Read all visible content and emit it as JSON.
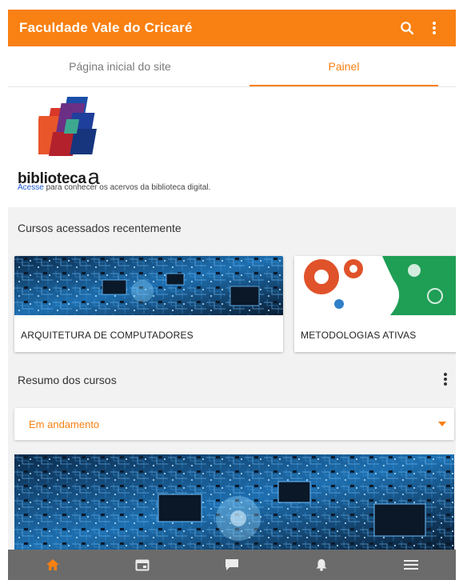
{
  "app": {
    "title": "Faculdade Vale do Cricaré",
    "accent_color": "#f98012",
    "actions": [
      {
        "icon": "search-icon"
      },
      {
        "icon": "kebab-menu-icon"
      }
    ]
  },
  "tabs": [
    {
      "label": "Página inicial do site",
      "active": false
    },
    {
      "label": "Painel",
      "active": true
    }
  ],
  "biblioteca": {
    "wordmark": "biblioteca",
    "wordmark_glyph": "a",
    "link_text": "Acesse",
    "caption_rest": " para conhecer os acervos da biblioteca digital."
  },
  "recent": {
    "header": "Cursos acessados recentemente",
    "courses": [
      {
        "title": "ARQUITETURA DE COMPUTADORES",
        "image": "circuit-board"
      },
      {
        "title": "METODOLOGIAS ATIVAS",
        "image": "gears-head"
      }
    ]
  },
  "summary": {
    "header": "Resumo dos cursos",
    "filter_value": "Em andamento"
  },
  "bottom_nav": [
    {
      "icon": "home-icon",
      "active": true
    },
    {
      "icon": "calendar-icon",
      "active": false
    },
    {
      "icon": "messages-icon",
      "active": false
    },
    {
      "icon": "bell-icon",
      "active": false
    },
    {
      "icon": "menu-icon",
      "active": false
    }
  ]
}
